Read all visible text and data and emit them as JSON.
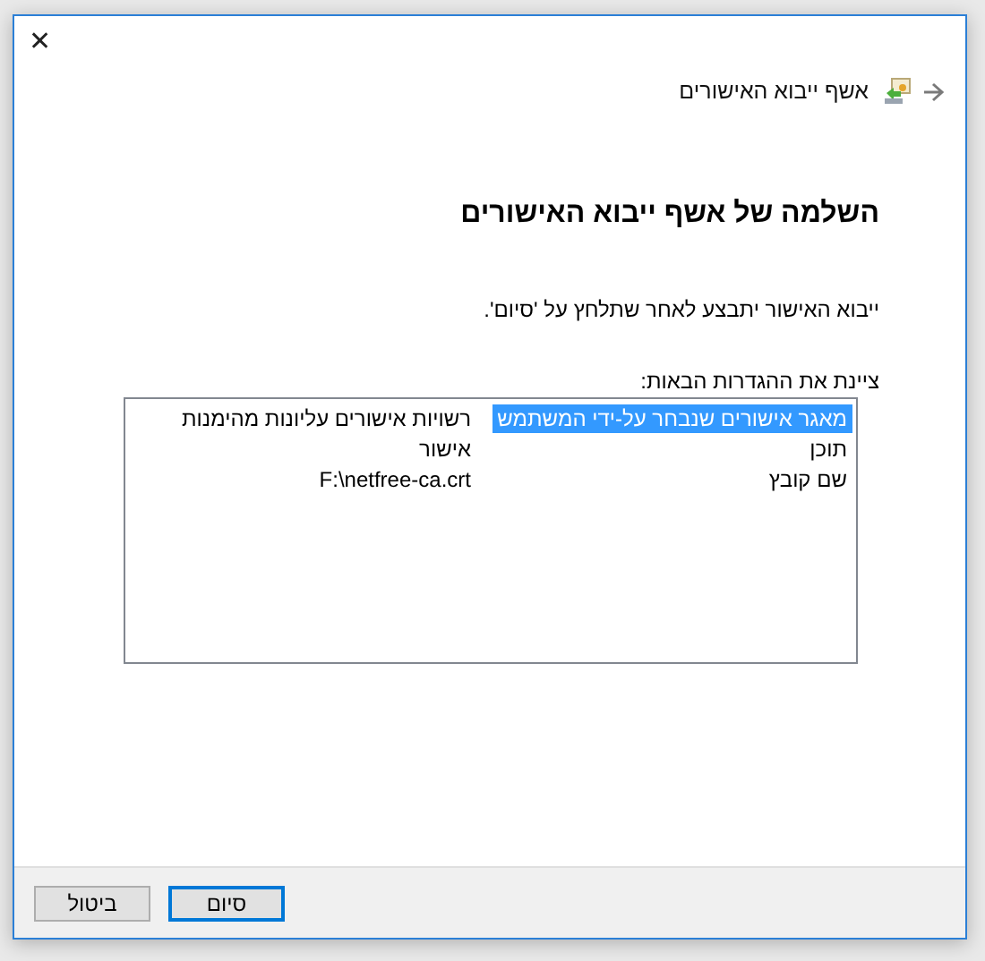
{
  "window": {
    "close": "✕"
  },
  "header": {
    "title": "אשף ייבוא האישורים"
  },
  "heading": "השלמה של אשף ייבוא האישורים",
  "description": "ייבוא האישור יתבצע לאחר שתלחץ על 'סיום'.",
  "settings_label": "ציינת את ההגדרות הבאות:",
  "settings": [
    {
      "name": "מאגר אישורים שנבחר על-ידי המשתמש",
      "value": "רשויות אישורים עליונות מהימנות",
      "selected": true
    },
    {
      "name": "תוכן",
      "value": "אישור",
      "selected": false
    },
    {
      "name": "שם קובץ",
      "value": "F:\\netfree-ca.crt",
      "selected": false
    }
  ],
  "buttons": [
    {
      "label": "סיום",
      "default": true
    },
    {
      "label": "ביטול",
      "default": false
    }
  ]
}
